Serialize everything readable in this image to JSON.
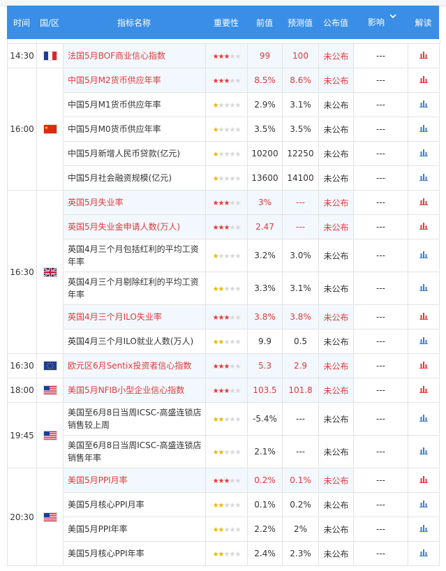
{
  "header": {
    "time": "时间",
    "country": "国/区",
    "indicator": "指标名称",
    "importance": "重要性",
    "previous": "前值",
    "forecast": "预测值",
    "actual": "公布值",
    "impact": "影响",
    "interpret": "解读"
  },
  "colors": {
    "header_bg": "#3a8ee6",
    "highlight": "#e03a3a",
    "row_highlight_bg": "#f2f8fe",
    "star_high": "#e53935",
    "star_low": "#e6b800"
  },
  "groups": [
    {
      "time": "14:30",
      "flag": "france-flag-icon",
      "rows": [
        {
          "name": "法国5月BOF商业信心指数",
          "stars": 3,
          "previous": "99",
          "forecast": "100",
          "actual": "未公布",
          "impact": "---",
          "highlight": true
        }
      ]
    },
    {
      "time": "16:00",
      "flag": "china-flag-icon",
      "rows": [
        {
          "name": "中国5月M2货币供应年率",
          "stars": 3,
          "previous": "8.5%",
          "forecast": "8.6%",
          "actual": "未公布",
          "impact": "---",
          "highlight": true
        },
        {
          "name": "中国5月M1货币供应年率",
          "stars": 1,
          "previous": "2.9%",
          "forecast": "3.1%",
          "actual": "未公布",
          "impact": "---",
          "highlight": false
        },
        {
          "name": "中国5月M0货币供应年率",
          "stars": 1,
          "previous": "3.5%",
          "forecast": "3.5%",
          "actual": "未公布",
          "impact": "---",
          "highlight": false
        },
        {
          "name": "中国5月新增人民币贷款(亿元)",
          "stars": 1,
          "previous": "10200",
          "forecast": "12250",
          "actual": "未公布",
          "impact": "---",
          "highlight": false
        },
        {
          "name": "中国5月社会融资规模(亿元)",
          "stars": 1,
          "previous": "13600",
          "forecast": "14100",
          "actual": "未公布",
          "impact": "---",
          "highlight": false
        }
      ]
    },
    {
      "time": "16:30",
      "flag": "uk-flag-icon",
      "rows": [
        {
          "name": "英国5月失业率",
          "stars": 3,
          "previous": "3%",
          "forecast": "---",
          "actual": "未公布",
          "impact": "---",
          "highlight": true
        },
        {
          "name": "英国5月失业金申请人数(万人)",
          "stars": 3,
          "previous": "2.47",
          "forecast": "---",
          "actual": "未公布",
          "impact": "---",
          "highlight": true
        },
        {
          "name": "英国4月三个月包括红利的平均工资年率",
          "stars": 1,
          "previous": "3.2%",
          "forecast": "3.0%",
          "actual": "未公布",
          "impact": "---",
          "highlight": false,
          "tall": true
        },
        {
          "name": "英国4月三个月剔除红利的平均工资年率",
          "stars": 2,
          "previous": "3.3%",
          "forecast": "3.1%",
          "actual": "未公布",
          "impact": "---",
          "highlight": false,
          "tall": true
        },
        {
          "name": "英国4月三个月ILO失业率",
          "stars": 3,
          "previous": "3.8%",
          "forecast": "3.8%",
          "actual": "未公布",
          "impact": "---",
          "highlight": true
        },
        {
          "name": "英国4月三个月ILO就业人数(万人)",
          "stars": 2,
          "previous": "9.9",
          "forecast": "0.5",
          "actual": "未公布",
          "impact": "---",
          "highlight": false
        }
      ]
    },
    {
      "time": "16:30",
      "flag": "eu-flag-icon",
      "rows": [
        {
          "name": "欧元区6月Sentix投资者信心指数",
          "stars": 3,
          "previous": "5.3",
          "forecast": "2.9",
          "actual": "未公布",
          "impact": "---",
          "highlight": true
        }
      ]
    },
    {
      "time": "18:00",
      "flag": "us-flag-icon",
      "rows": [
        {
          "name": "美国5月NFIB小型企业信心指数",
          "stars": 3,
          "previous": "103.5",
          "forecast": "101.8",
          "actual": "未公布",
          "impact": "---",
          "highlight": true
        }
      ]
    },
    {
      "time": "19:45",
      "flag": "us-flag-icon",
      "rows": [
        {
          "name": "美国至6月8日当周ICSC-高盛连锁店销售较上周",
          "stars": 2,
          "previous": "-5.4%",
          "forecast": "---",
          "actual": "未公布",
          "impact": "---",
          "highlight": false,
          "tall": true
        },
        {
          "name": "美国至6月8日当周ICSC-高盛连锁店销售年率",
          "stars": 2,
          "previous": "2.1%",
          "forecast": "---",
          "actual": "未公布",
          "impact": "---",
          "highlight": false,
          "tall": true
        }
      ]
    },
    {
      "time": "20:30",
      "flag": "us-flag-icon",
      "rows": [
        {
          "name": "美国5月PPI月率",
          "stars": 3,
          "previous": "0.2%",
          "forecast": "0.1%",
          "actual": "未公布",
          "impact": "---",
          "highlight": true
        },
        {
          "name": "美国5月核心PPI月率",
          "stars": 2,
          "previous": "0.1%",
          "forecast": "0.2%",
          "actual": "未公布",
          "impact": "---",
          "highlight": false
        },
        {
          "name": "美国5月PPI年率",
          "stars": 2,
          "previous": "2.2%",
          "forecast": "2%",
          "actual": "未公布",
          "impact": "---",
          "highlight": false
        },
        {
          "name": "美国5月核心PPI年率",
          "stars": 2,
          "previous": "2.4%",
          "forecast": "2.3%",
          "actual": "未公布",
          "impact": "---",
          "highlight": false
        }
      ]
    }
  ]
}
